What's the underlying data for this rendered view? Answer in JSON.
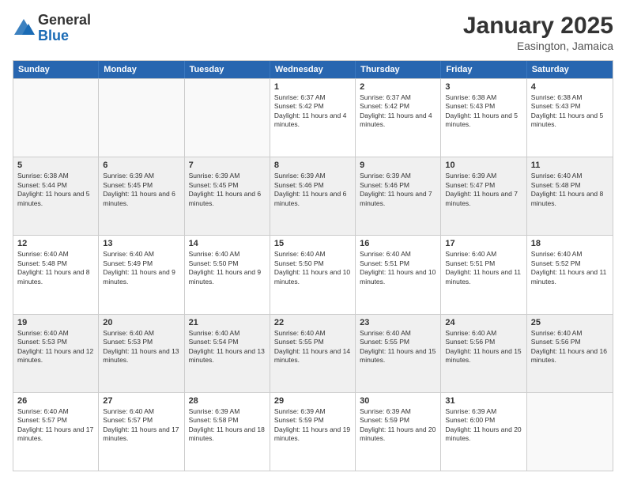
{
  "logo": {
    "general": "General",
    "blue": "Blue"
  },
  "header": {
    "month": "January 2025",
    "location": "Easington, Jamaica"
  },
  "days": [
    "Sunday",
    "Monday",
    "Tuesday",
    "Wednesday",
    "Thursday",
    "Friday",
    "Saturday"
  ],
  "rows": [
    [
      {
        "day": "",
        "info": ""
      },
      {
        "day": "",
        "info": ""
      },
      {
        "day": "",
        "info": ""
      },
      {
        "day": "1",
        "info": "Sunrise: 6:37 AM\nSunset: 5:42 PM\nDaylight: 11 hours and 4 minutes."
      },
      {
        "day": "2",
        "info": "Sunrise: 6:37 AM\nSunset: 5:42 PM\nDaylight: 11 hours and 4 minutes."
      },
      {
        "day": "3",
        "info": "Sunrise: 6:38 AM\nSunset: 5:43 PM\nDaylight: 11 hours and 5 minutes."
      },
      {
        "day": "4",
        "info": "Sunrise: 6:38 AM\nSunset: 5:43 PM\nDaylight: 11 hours and 5 minutes."
      }
    ],
    [
      {
        "day": "5",
        "info": "Sunrise: 6:38 AM\nSunset: 5:44 PM\nDaylight: 11 hours and 5 minutes."
      },
      {
        "day": "6",
        "info": "Sunrise: 6:39 AM\nSunset: 5:45 PM\nDaylight: 11 hours and 6 minutes."
      },
      {
        "day": "7",
        "info": "Sunrise: 6:39 AM\nSunset: 5:45 PM\nDaylight: 11 hours and 6 minutes."
      },
      {
        "day": "8",
        "info": "Sunrise: 6:39 AM\nSunset: 5:46 PM\nDaylight: 11 hours and 6 minutes."
      },
      {
        "day": "9",
        "info": "Sunrise: 6:39 AM\nSunset: 5:46 PM\nDaylight: 11 hours and 7 minutes."
      },
      {
        "day": "10",
        "info": "Sunrise: 6:39 AM\nSunset: 5:47 PM\nDaylight: 11 hours and 7 minutes."
      },
      {
        "day": "11",
        "info": "Sunrise: 6:40 AM\nSunset: 5:48 PM\nDaylight: 11 hours and 8 minutes."
      }
    ],
    [
      {
        "day": "12",
        "info": "Sunrise: 6:40 AM\nSunset: 5:48 PM\nDaylight: 11 hours and 8 minutes."
      },
      {
        "day": "13",
        "info": "Sunrise: 6:40 AM\nSunset: 5:49 PM\nDaylight: 11 hours and 9 minutes."
      },
      {
        "day": "14",
        "info": "Sunrise: 6:40 AM\nSunset: 5:50 PM\nDaylight: 11 hours and 9 minutes."
      },
      {
        "day": "15",
        "info": "Sunrise: 6:40 AM\nSunset: 5:50 PM\nDaylight: 11 hours and 10 minutes."
      },
      {
        "day": "16",
        "info": "Sunrise: 6:40 AM\nSunset: 5:51 PM\nDaylight: 11 hours and 10 minutes."
      },
      {
        "day": "17",
        "info": "Sunrise: 6:40 AM\nSunset: 5:51 PM\nDaylight: 11 hours and 11 minutes."
      },
      {
        "day": "18",
        "info": "Sunrise: 6:40 AM\nSunset: 5:52 PM\nDaylight: 11 hours and 11 minutes."
      }
    ],
    [
      {
        "day": "19",
        "info": "Sunrise: 6:40 AM\nSunset: 5:53 PM\nDaylight: 11 hours and 12 minutes."
      },
      {
        "day": "20",
        "info": "Sunrise: 6:40 AM\nSunset: 5:53 PM\nDaylight: 11 hours and 13 minutes."
      },
      {
        "day": "21",
        "info": "Sunrise: 6:40 AM\nSunset: 5:54 PM\nDaylight: 11 hours and 13 minutes."
      },
      {
        "day": "22",
        "info": "Sunrise: 6:40 AM\nSunset: 5:55 PM\nDaylight: 11 hours and 14 minutes."
      },
      {
        "day": "23",
        "info": "Sunrise: 6:40 AM\nSunset: 5:55 PM\nDaylight: 11 hours and 15 minutes."
      },
      {
        "day": "24",
        "info": "Sunrise: 6:40 AM\nSunset: 5:56 PM\nDaylight: 11 hours and 15 minutes."
      },
      {
        "day": "25",
        "info": "Sunrise: 6:40 AM\nSunset: 5:56 PM\nDaylight: 11 hours and 16 minutes."
      }
    ],
    [
      {
        "day": "26",
        "info": "Sunrise: 6:40 AM\nSunset: 5:57 PM\nDaylight: 11 hours and 17 minutes."
      },
      {
        "day": "27",
        "info": "Sunrise: 6:40 AM\nSunset: 5:57 PM\nDaylight: 11 hours and 17 minutes."
      },
      {
        "day": "28",
        "info": "Sunrise: 6:39 AM\nSunset: 5:58 PM\nDaylight: 11 hours and 18 minutes."
      },
      {
        "day": "29",
        "info": "Sunrise: 6:39 AM\nSunset: 5:59 PM\nDaylight: 11 hours and 19 minutes."
      },
      {
        "day": "30",
        "info": "Sunrise: 6:39 AM\nSunset: 5:59 PM\nDaylight: 11 hours and 20 minutes."
      },
      {
        "day": "31",
        "info": "Sunrise: 6:39 AM\nSunset: 6:00 PM\nDaylight: 11 hours and 20 minutes."
      },
      {
        "day": "",
        "info": ""
      }
    ]
  ]
}
